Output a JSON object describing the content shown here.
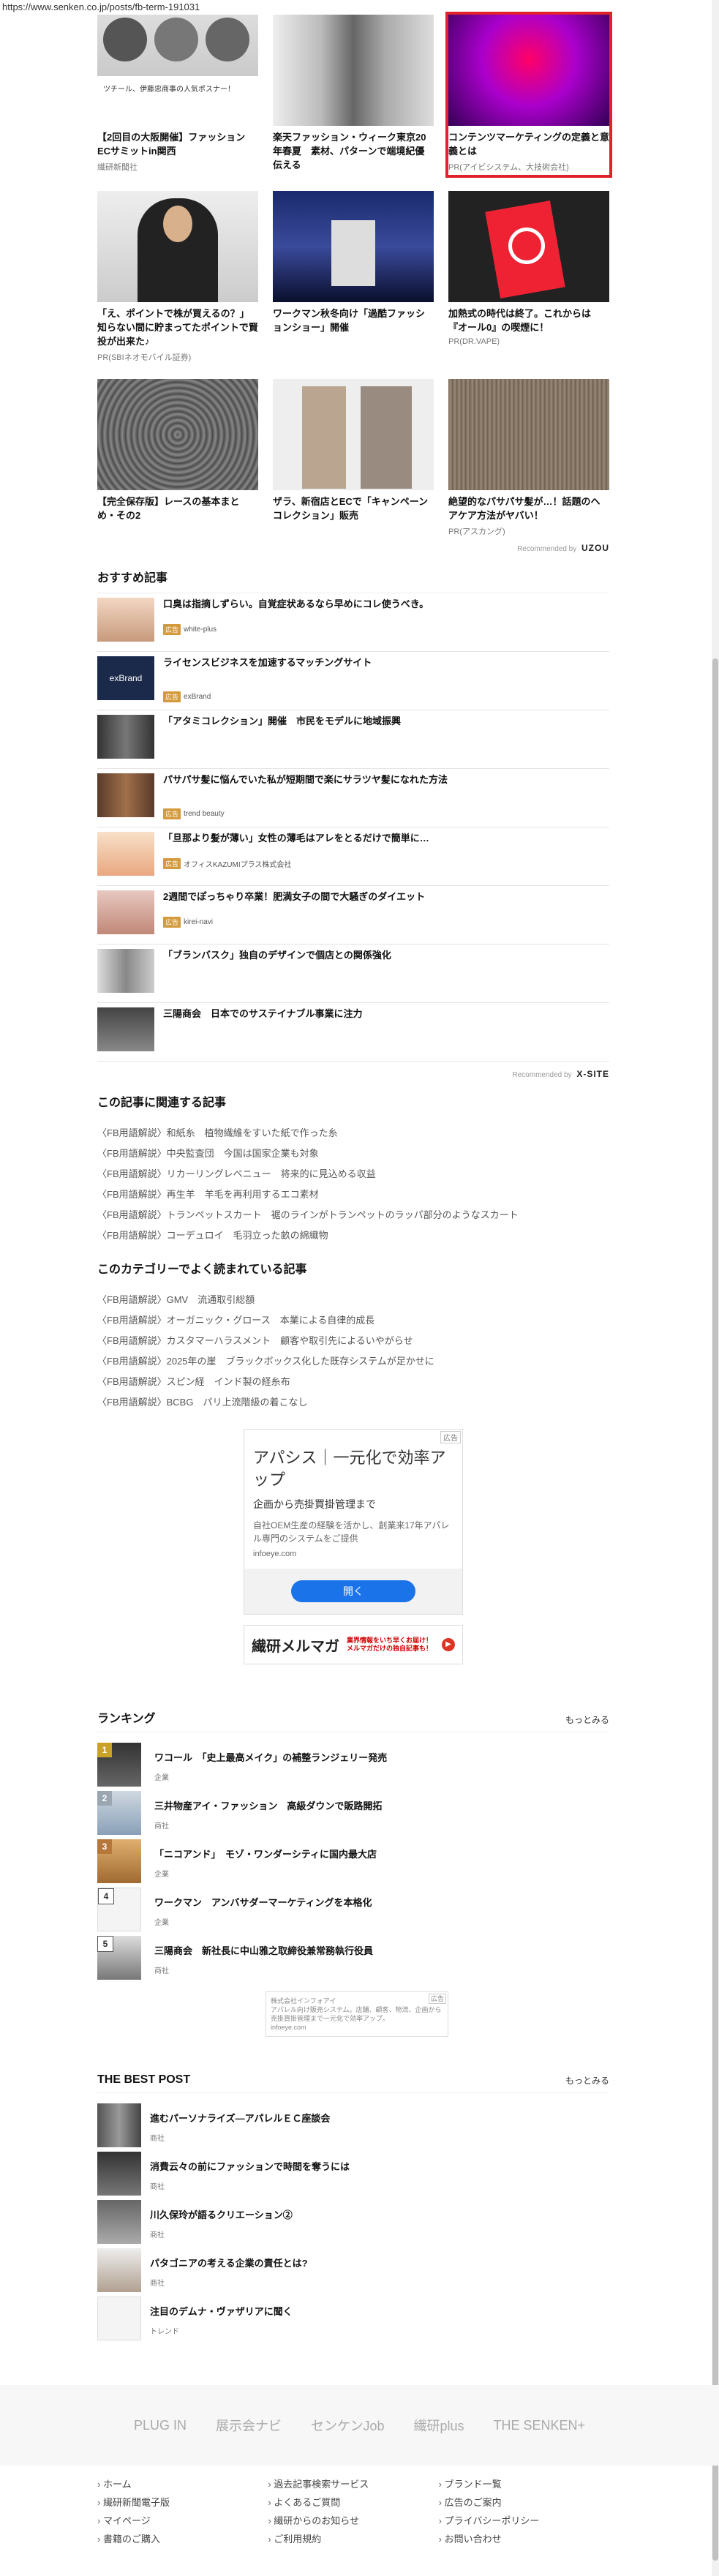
{
  "browser": {
    "url": "https://www.senken.co.jp/posts/fb-term-191031"
  },
  "ad_grid": [
    {
      "title": "【2回目の大阪開催】ファッションECサミットin関西",
      "source": "繊研新聞社",
      "overlay": "ツチール、伊藤忠商事の人気ポスナー！"
    },
    {
      "title": "楽天ファッション・ウィーク東京20年春夏　素材、パターンで端境紀優伝える",
      "source": ""
    },
    {
      "title": "コンテンツマーケティングの定義と意義とは",
      "source": "PR(アイビシステム、大技術会社)",
      "highlight": true
    },
    {
      "title": "「え、ポイントで株が買えるの？」知らない間に貯まってたポイントで賢投が出来た♪",
      "source": "PR(SBIネオモバイル証券)"
    },
    {
      "title": "ワークマン秋冬向け「過酷ファッションショー」開催",
      "source": ""
    },
    {
      "title": "加熱式の時代は終了。これからは『オール0』の喫煙に！",
      "source": "PR(DR.VAPE)"
    },
    {
      "title": "【完全保存版】レースの基本まとめ・その2",
      "source": ""
    },
    {
      "title": "ザラ、新宿店とECで「キャンペーンコレクション」販売",
      "source": ""
    },
    {
      "title": "絶望的なパサパサ髪が…！話題のヘアケア方法がヤバい！",
      "source": "PR(アスカング)"
    }
  ],
  "recommended_by_1": {
    "label": "Recommended by",
    "brand": "UZOU"
  },
  "osusume": {
    "title": "おすすめ記事",
    "items": [
      {
        "title": "口臭は指摘しずらい。自覚症状あるなら早めにコレ使うべき。",
        "pr": "広告",
        "source": "white-plus"
      },
      {
        "title": "ライセンスビジネスを加速するマッチングサイト",
        "pr": "広告",
        "source": "exBrand"
      },
      {
        "title": "「アタミコレクション」開催　市民をモデルに地域振興",
        "pr": "",
        "source": ""
      },
      {
        "title": "パサパサ髪に悩んでいた私が短期間で楽にサラツヤ髪になれた方法",
        "pr": "広告",
        "source": "trend beauty"
      },
      {
        "title": "「旦那より髪が薄い」女性の薄毛はアレをとるだけで簡単に…",
        "pr": "広告",
        "source": "オフィスKAZUMIプラス株式会社"
      },
      {
        "title": "2週間でぽっちゃり卒業！肥満女子の間で大騒ぎのダイエット",
        "pr": "広告",
        "source": "kirei-navi"
      },
      {
        "title": "「ブランバスク」独自のデザインで個店との関係強化",
        "pr": "",
        "source": ""
      },
      {
        "title": "三陽商会　日本でのサステイナブル事業に注力",
        "pr": "",
        "source": ""
      }
    ],
    "recommended_by": "Recommended by",
    "brand": "X-SITE"
  },
  "related": {
    "title": "この記事に関連する記事",
    "items": [
      "〈FB用語解説〉和紙糸　植物繊維をすいた紙で作った糸",
      "〈FB用語解説〉中央監査団　今国は国家企業も対象",
      "〈FB用語解説〉リカーリングレベニュー　将来的に見込める収益",
      "〈FB用語解説〉再生羊　羊毛を再利用するエコ素材",
      "〈FB用語解説〉トランペットスカート　裾のラインがトランペットのラッパ部分のようなスカート",
      "〈FB用語解説〉コーデュロイ　毛羽立った畝の綿織物"
    ]
  },
  "popular_category": {
    "title": "このカテゴリーでよく読まれている記事",
    "items": [
      "〈FB用語解説〉GMV　流通取引総額",
      "〈FB用語解説〉オーガニック・グロース　本業による自律的成長",
      "〈FB用語解説〉カスタマーハラスメント　顧客や取引先によるいやがらせ",
      "〈FB用語解説〉2025年の崖　ブラックボックス化した既存システムが足かせに",
      "〈FB用語解説〉スピン経　インド製の経糸布",
      "〈FB用語解説〉BCBG　パリ上流階級の着こなし"
    ]
  },
  "adbox": {
    "label": "広告",
    "title": "アパシス｜一元化で効率アップ",
    "sub": "企画から売掛買掛管理まで",
    "desc": "自社OEM生産の経験を活かし、創業来17年アパレル専門のシステムをご提供",
    "domain": "infoeye.com",
    "button": "開く"
  },
  "mailmag": {
    "logo": "繊研メルマガ",
    "text": "業界情報をいち早くお届け！メルマガだけの独自記事も！"
  },
  "ranking": {
    "title": "ランキング",
    "more": "もっとみる",
    "items": [
      {
        "num": "1",
        "title": "ワコール　「史上最高メイク」の補整ランジェリー発売",
        "cat": "企業",
        "color": "#c9a227"
      },
      {
        "num": "2",
        "title": "三井物産アイ・ファッション　高級ダウンで販路開拓",
        "cat": "商社",
        "color": "#9aa6b2"
      },
      {
        "num": "3",
        "title": "「ニコアンド」　モゾ・ワンダーシティに国内最大店",
        "cat": "企業",
        "color": "#b5773a"
      },
      {
        "num": "4",
        "title": "ワークマン　アンバサダーマーケティングを本格化",
        "cat": "企業",
        "color": "#555555"
      },
      {
        "num": "5",
        "title": "三陽商会　新社長に中山雅之取締役兼常務執行役員",
        "cat": "商社",
        "color": "#555555"
      }
    ],
    "small_ad": {
      "label": "広告",
      "company": "株式会社インフォアイ",
      "text": "アパレル向け販売システム。店舗、顧客、物流、企画から売掛買掛管理まで一元化で効率アップ。",
      "domain": "infoeye.com"
    }
  },
  "best_post": {
    "title": "THE BEST POST",
    "more": "もっとみる",
    "items": [
      {
        "title": "進むパーソナライズ―アパレルＥＣ座談会",
        "cat": "商社"
      },
      {
        "title": "消費云々の前にファッションで時間を奪うには",
        "cat": "商社"
      },
      {
        "title": "川久保玲が語るクリエーション②",
        "cat": "商社"
      },
      {
        "title": "パタゴニアの考える企業の責任とは?",
        "cat": "商社"
      },
      {
        "title": "注目のデムナ・ヴァザリアに聞く",
        "cat": "トレンド"
      }
    ]
  },
  "footer": {
    "logos": [
      "PLUG IN",
      "展示会ナビ",
      "センケンJob",
      "繊研plus",
      "THE SENKEN+"
    ],
    "links": [
      "ホーム",
      "過去記事検索サービス",
      "ブランド一覧",
      "繊研新聞電子版",
      "よくあるご質問",
      "広告のご案内",
      "マイページ",
      "繊研からのお知らせ",
      "プライバシーポリシー",
      "書籍のご購入",
      "ご利用規約",
      "お問い合わせ"
    ]
  }
}
